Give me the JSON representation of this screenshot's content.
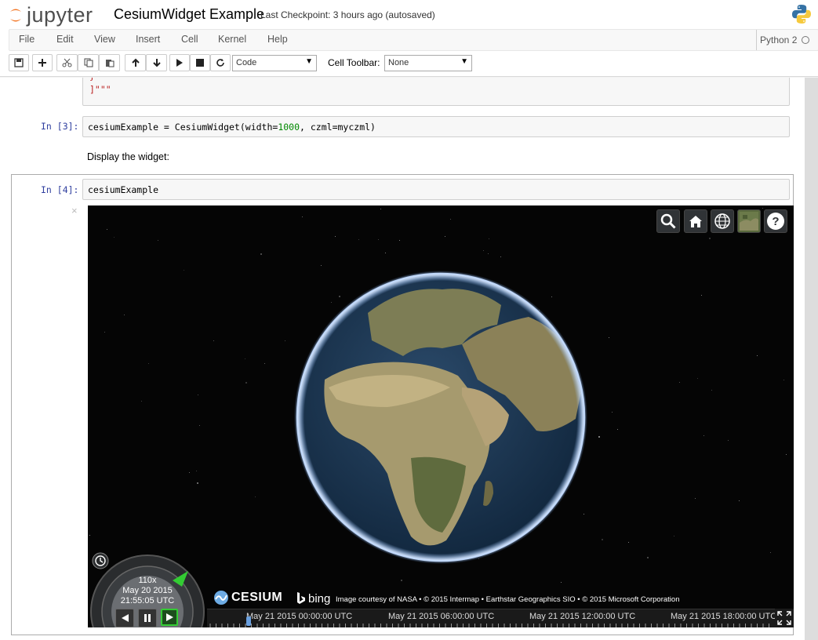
{
  "header": {
    "logo_text": "jupyter",
    "notebook_name": "CesiumWidget Example",
    "checkpoint": "Last Checkpoint: 3 hours ago (autosaved)"
  },
  "menu": {
    "items": [
      "File",
      "Edit",
      "View",
      "Insert",
      "Cell",
      "Kernel",
      "Help"
    ],
    "kernel": "Python 2"
  },
  "toolbar": {
    "cell_type": "Code",
    "cell_toolbar_label": "Cell Toolbar:",
    "cell_toolbar_value": "None",
    "icons": [
      "save-icon",
      "plus-icon",
      "cut-icon",
      "copy-icon",
      "paste-icon",
      "arrow-up-icon",
      "arrow-down-icon",
      "run-icon",
      "stop-icon",
      "restart-icon"
    ]
  },
  "cells": {
    "prev_tail_line1": "  }",
    "prev_tail_line2": "]\"\"\"",
    "c3_prompt": "In [3]:",
    "c3_code_a": "cesiumExample = CesiumWidget(width=",
    "c3_code_num": "1000",
    "c3_code_b": ", czml=myczml)",
    "markdown": "Display the widget:",
    "c4_prompt": "In [4]:",
    "c4_code": "cesiumExample",
    "close": "×"
  },
  "cesium": {
    "animation": {
      "speed": "110x",
      "date": "May 20 2015",
      "time": "21:55:05 UTC"
    },
    "logo_text": "CESIUM",
    "bing_text": "bing",
    "credit": "Image courtesy of NASA • © 2015 Intermap • Earthstar Geographics SIO • © 2015 Microsoft Corporation",
    "timeline_labels": [
      "May 21 2015 00:00:00 UTC",
      "May 21 2015 06:00:00 UTC",
      "May 21 2015 12:00:00 UTC",
      "May 21 2015 18:00:00 UTC"
    ],
    "toolbar_icons": [
      "search-icon",
      "home-icon",
      "globe-icon",
      "imagery-icon",
      "help-icon"
    ]
  },
  "colors": {
    "prompt": "#303f9f",
    "number": "#008800",
    "string": "#bb2222",
    "accent": "#f37726"
  }
}
